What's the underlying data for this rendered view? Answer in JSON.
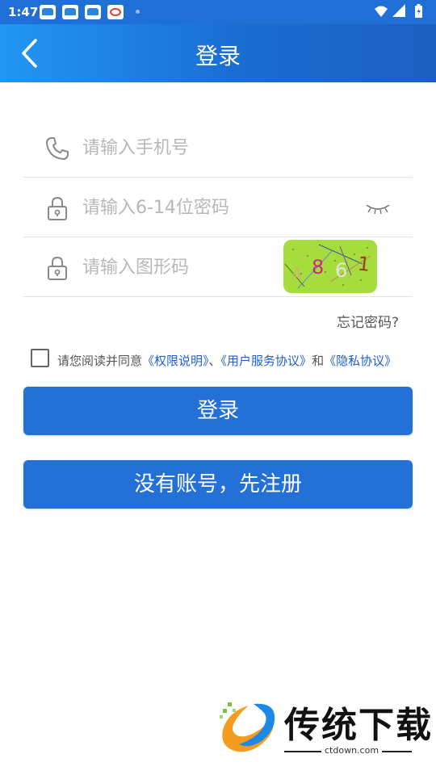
{
  "status_bar": {
    "time": "1:47",
    "notification_icons": [
      "car-app-icon",
      "car-app-icon",
      "car-app-icon",
      "red-app-icon"
    ],
    "system_icons": [
      "wifi-icon",
      "signal-icon",
      "battery-charging-icon"
    ]
  },
  "header": {
    "title": "登录",
    "back_icon": "chevron-left-icon",
    "gradient": [
      "#2196f3",
      "#1c5fc1"
    ]
  },
  "form": {
    "phone": {
      "placeholder": "请输入手机号",
      "value": "",
      "icon": "phone-icon"
    },
    "password": {
      "placeholder": "请输入6-14位密码",
      "value": "",
      "icon": "lock-icon",
      "toggle_icon": "eye-closed-icon"
    },
    "captcha": {
      "placeholder": "请输入图形码",
      "value": "",
      "icon": "lock-icon",
      "image_text": [
        "4",
        "8",
        "6",
        "1"
      ]
    }
  },
  "forgot_password": "忘记密码?",
  "agreement": {
    "checked": false,
    "prefix": "请您阅读并同意",
    "link1": "《权限说明》",
    "sep1": "、",
    "link2": "《用户服务协议》",
    "sep2": "和",
    "link3": "《隐私协议》"
  },
  "buttons": {
    "login": "登录",
    "register": "没有账号，先注册"
  },
  "watermark": {
    "name": "传统下载",
    "url": "ctdown.com"
  },
  "colors": {
    "primary": "#2370d6",
    "link": "#1f5fd0",
    "captcha_bg": "#a6dd3c"
  }
}
